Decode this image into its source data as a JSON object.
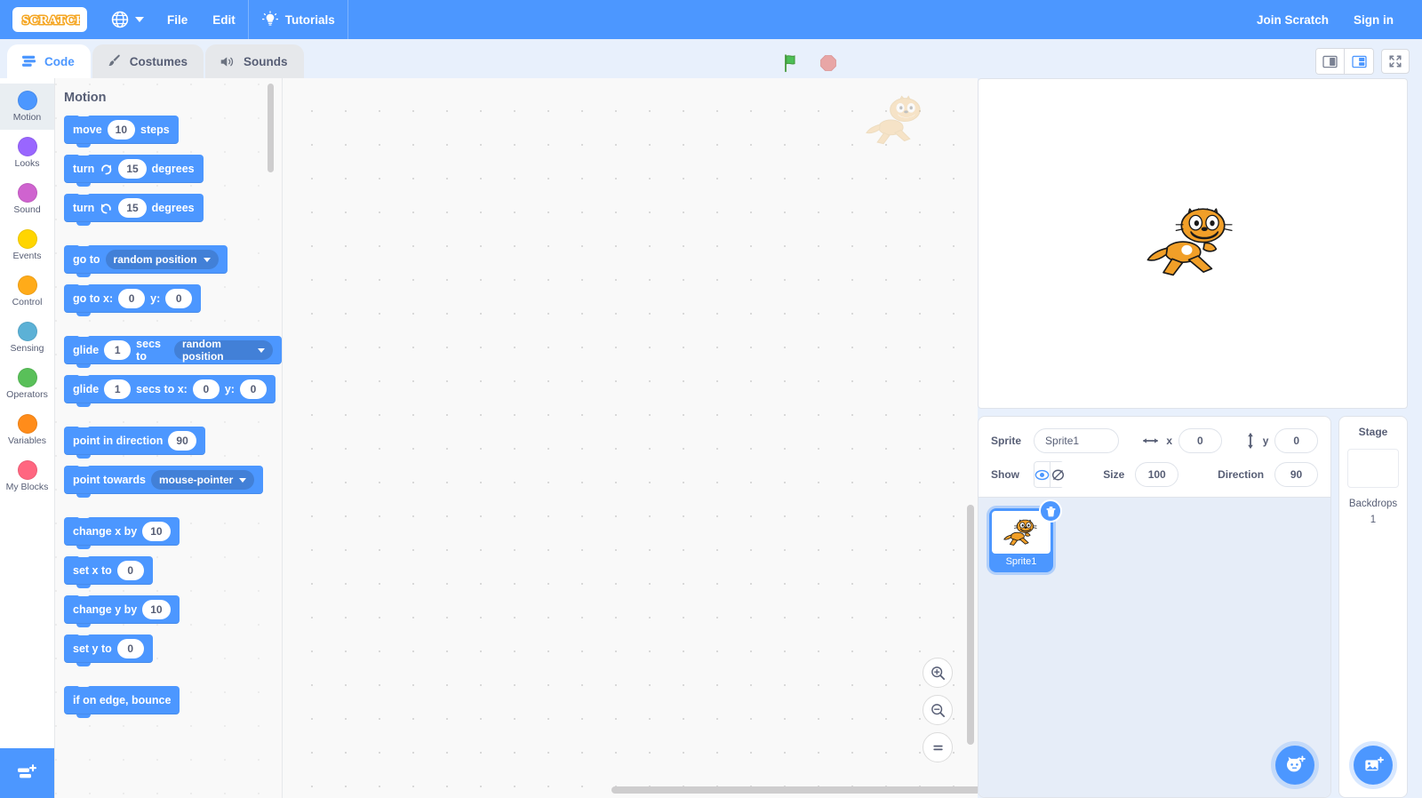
{
  "menubar": {
    "logo_text": "SCRATCH",
    "language_icon": "globe-icon",
    "items": [
      {
        "label": "File"
      },
      {
        "label": "Edit"
      }
    ],
    "tutorials": {
      "label": "Tutorials",
      "icon": "lightbulb-icon"
    },
    "account": {
      "join": "Join Scratch",
      "signin": "Sign in"
    }
  },
  "tabs": [
    {
      "label": "Code",
      "icon": "code-blocks-icon",
      "active": true
    },
    {
      "label": "Costumes",
      "icon": "paintbrush-icon",
      "active": false
    },
    {
      "label": "Sounds",
      "icon": "speaker-icon",
      "active": false
    }
  ],
  "stage_controls": {
    "green_flag": "green-flag-icon",
    "stop": "stop-sign-icon",
    "small_stage": "small-stage-icon",
    "large_stage": "large-stage-icon",
    "fullscreen": "fullscreen-icon"
  },
  "categories": [
    {
      "label": "Motion",
      "color": "#4C97FF",
      "selected": true
    },
    {
      "label": "Looks",
      "color": "#9966FF",
      "selected": false
    },
    {
      "label": "Sound",
      "color": "#CF63CF",
      "selected": false
    },
    {
      "label": "Events",
      "color": "#FFD500",
      "selected": false
    },
    {
      "label": "Control",
      "color": "#FFAB19",
      "selected": false
    },
    {
      "label": "Sensing",
      "color": "#5CB1D6",
      "selected": false
    },
    {
      "label": "Operators",
      "color": "#59C059",
      "selected": false
    },
    {
      "label": "Variables",
      "color": "#FF8C1A",
      "selected": false
    },
    {
      "label": "My Blocks",
      "color": "#FF6680",
      "selected": false
    }
  ],
  "extension_button": {
    "icon": "add-extension-icon"
  },
  "palette": {
    "header": "Motion",
    "blocks": [
      {
        "id": "move",
        "parts": [
          {
            "t": "text",
            "v": "move"
          },
          {
            "t": "input",
            "v": "10"
          },
          {
            "t": "text",
            "v": "steps"
          }
        ]
      },
      {
        "id": "turn-right",
        "parts": [
          {
            "t": "text",
            "v": "turn"
          },
          {
            "t": "icon",
            "v": "turn-clockwise-icon"
          },
          {
            "t": "input",
            "v": "15"
          },
          {
            "t": "text",
            "v": "degrees"
          }
        ]
      },
      {
        "id": "turn-left",
        "parts": [
          {
            "t": "text",
            "v": "turn"
          },
          {
            "t": "icon",
            "v": "turn-counterclockwise-icon"
          },
          {
            "t": "input",
            "v": "15"
          },
          {
            "t": "text",
            "v": "degrees"
          }
        ]
      },
      {
        "id": "go-to",
        "gap": true,
        "parts": [
          {
            "t": "text",
            "v": "go to"
          },
          {
            "t": "dropdown",
            "v": "random position"
          }
        ]
      },
      {
        "id": "go-to-xy",
        "parts": [
          {
            "t": "text",
            "v": "go to x:"
          },
          {
            "t": "input",
            "v": "0"
          },
          {
            "t": "text",
            "v": "y:"
          },
          {
            "t": "input",
            "v": "0"
          }
        ]
      },
      {
        "id": "glide-to",
        "gap": true,
        "parts": [
          {
            "t": "text",
            "v": "glide"
          },
          {
            "t": "input",
            "v": "1"
          },
          {
            "t": "text",
            "v": "secs to"
          },
          {
            "t": "dropdown",
            "v": "random position"
          }
        ]
      },
      {
        "id": "glide-xy",
        "parts": [
          {
            "t": "text",
            "v": "glide"
          },
          {
            "t": "input",
            "v": "1"
          },
          {
            "t": "text",
            "v": "secs to x:"
          },
          {
            "t": "input",
            "v": "0"
          },
          {
            "t": "text",
            "v": "y:"
          },
          {
            "t": "input",
            "v": "0"
          }
        ]
      },
      {
        "id": "point-dir",
        "gap": true,
        "parts": [
          {
            "t": "text",
            "v": "point in direction"
          },
          {
            "t": "input",
            "v": "90"
          }
        ]
      },
      {
        "id": "point-tow",
        "parts": [
          {
            "t": "text",
            "v": "point towards"
          },
          {
            "t": "dropdown",
            "v": "mouse-pointer"
          }
        ]
      },
      {
        "id": "change-x",
        "gap": true,
        "parts": [
          {
            "t": "text",
            "v": "change x by"
          },
          {
            "t": "input",
            "v": "10"
          }
        ]
      },
      {
        "id": "set-x",
        "parts": [
          {
            "t": "text",
            "v": "set x to"
          },
          {
            "t": "input",
            "v": "0"
          }
        ]
      },
      {
        "id": "change-y",
        "parts": [
          {
            "t": "text",
            "v": "change y by"
          },
          {
            "t": "input",
            "v": "10"
          }
        ]
      },
      {
        "id": "set-y",
        "parts": [
          {
            "t": "text",
            "v": "set y to"
          },
          {
            "t": "input",
            "v": "0"
          }
        ]
      },
      {
        "id": "bounce",
        "gap": true,
        "parts": [
          {
            "t": "text",
            "v": "if on edge, bounce"
          }
        ]
      }
    ]
  },
  "workspace": {
    "zoom_in": "zoom-in-icon",
    "zoom_out": "zoom-out-icon",
    "zoom_reset": "zoom-reset-icon",
    "watermark": "sprite-watermark-cat"
  },
  "sprite_info": {
    "sprite_label": "Sprite",
    "sprite_name": "Sprite1",
    "x_label": "x",
    "x_value": "0",
    "y_label": "y",
    "y_value": "0",
    "show_label": "Show",
    "size_label": "Size",
    "size_value": "100",
    "direction_label": "Direction",
    "direction_value": "90"
  },
  "sprite_list": {
    "sprites": [
      {
        "name": "Sprite1",
        "selected": true
      }
    ],
    "add_button": "add-sprite-icon",
    "delete_button": "delete-icon"
  },
  "stage_pane": {
    "title": "Stage",
    "backdrops_label": "Backdrops",
    "backdrops_count": "1",
    "add_button": "add-backdrop-icon"
  },
  "colors": {
    "brand_blue": "#4C97FF",
    "motion_blue": "#4C97FF",
    "panel_bg": "#E8F0FC",
    "text_gray": "#575E75"
  }
}
